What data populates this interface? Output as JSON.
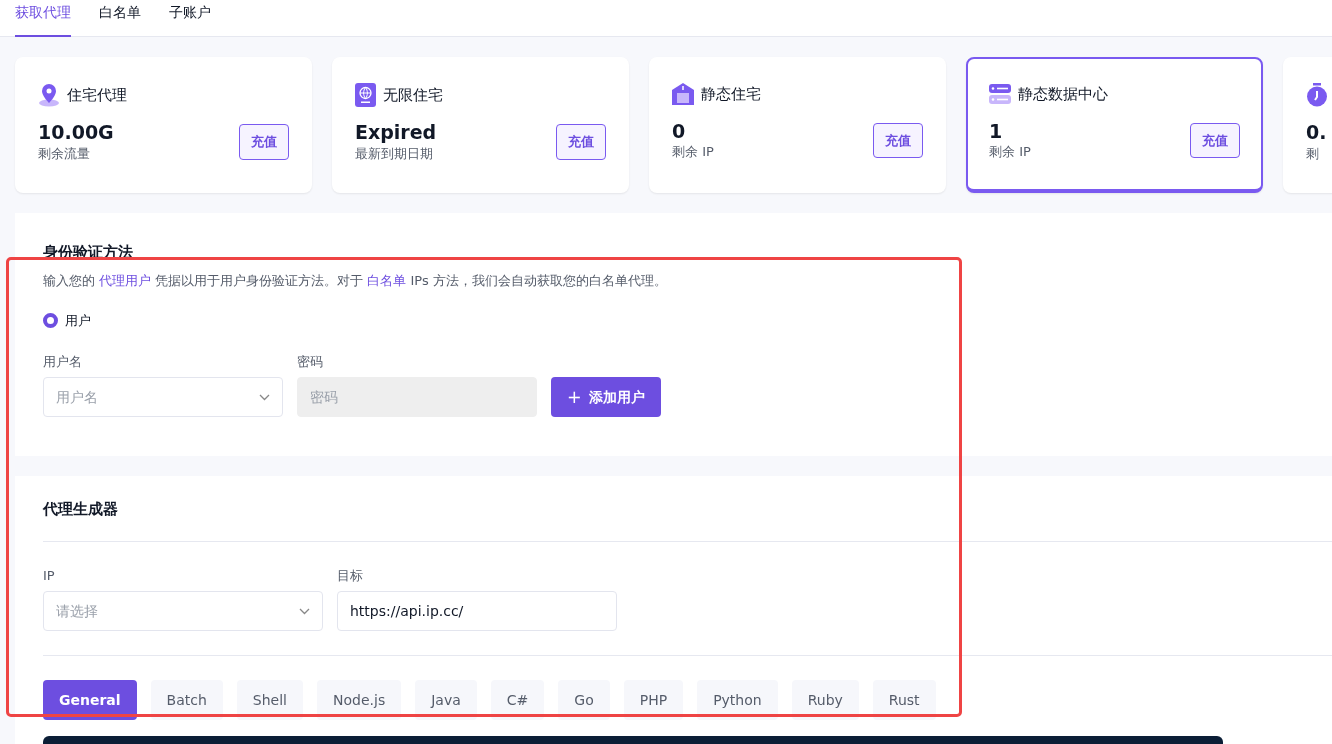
{
  "tabs": [
    {
      "label": "获取代理",
      "selected": true
    },
    {
      "label": "白名单",
      "selected": false
    },
    {
      "label": "子账户",
      "selected": false
    }
  ],
  "products": [
    {
      "kind": "pin",
      "title": "住宅代理",
      "value": "10.00G",
      "caption": "剩余流量",
      "button": "充值",
      "selected": false
    },
    {
      "kind": "globe",
      "title": "无限住宅",
      "value": "Expired",
      "caption": "最新到期日期",
      "button": "充值",
      "selected": false
    },
    {
      "kind": "house",
      "title": "静态住宅",
      "value": "0",
      "caption": "剩余 IP",
      "button": "充值",
      "selected": false
    },
    {
      "kind": "server",
      "title": "静态数据中心",
      "value": "1",
      "caption": "剩余 IP",
      "button": "充值",
      "selected": true
    },
    {
      "kind": "timer",
      "value": "0.",
      "caption": "剩",
      "selected": false
    }
  ],
  "auth": {
    "title": "身份验证方法",
    "description": "输入您的 ",
    "link1": "代理用户",
    "middle": " 凭据以用于用户身份验证方法。对于 ",
    "link2": "白名单",
    "tail": " IPs 方法，我们会自动获取您的白名单代理。",
    "radio": {
      "label": "用户",
      "checked": true
    },
    "username": {
      "label": "用户名",
      "placeholder": "用户名"
    },
    "password": {
      "label": "密码",
      "placeholder": "密码",
      "disabled": true
    },
    "add_button": {
      "icon": "+",
      "label": "添加用户"
    }
  },
  "generator": {
    "title": "代理生成器",
    "ip": {
      "label": "IP",
      "placeholder": "请选择"
    },
    "target": {
      "label": "目标",
      "value": "https://api.ip.cc/"
    },
    "languages": [
      {
        "label": "General",
        "selected": true
      },
      {
        "label": "Batch",
        "selected": false
      },
      {
        "label": "Shell",
        "selected": false
      },
      {
        "label": "Node.js",
        "selected": false
      },
      {
        "label": "Java",
        "selected": false
      },
      {
        "label": "C#",
        "selected": false
      },
      {
        "label": "Go",
        "selected": false
      },
      {
        "label": "PHP",
        "selected": false
      },
      {
        "label": "Python",
        "selected": false
      },
      {
        "label": "Ruby",
        "selected": false
      },
      {
        "label": "Rust",
        "selected": false
      }
    ]
  },
  "highlight": true
}
